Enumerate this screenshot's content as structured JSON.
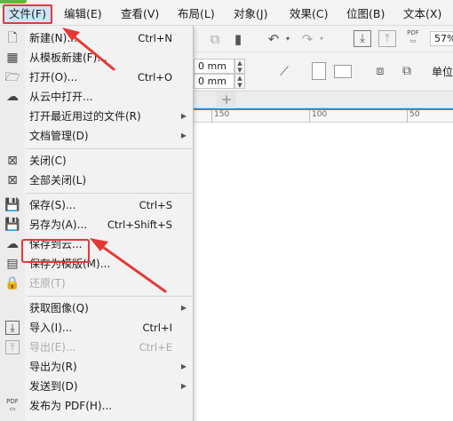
{
  "menubar": {
    "items": [
      {
        "label": "文件(F)"
      },
      {
        "label": "编辑(E)"
      },
      {
        "label": "查看(V)"
      },
      {
        "label": "布局(L)"
      },
      {
        "label": "对象(J)"
      },
      {
        "label": "效果(C)"
      },
      {
        "label": "位图(B)"
      },
      {
        "label": "文本(X)"
      }
    ]
  },
  "toolbar": {
    "zoom_value": "57%",
    "pdf_label": "PDF",
    "width_value": "0 mm",
    "height_value": "0 mm",
    "units_label": "单位"
  },
  "ruler": {
    "labels": [
      "150",
      "100",
      "50"
    ]
  },
  "file_menu": {
    "items": [
      {
        "label": "新建(N)...",
        "shortcut": "Ctrl+N",
        "icon": "new-document-icon"
      },
      {
        "label": "从模板新建(F)...",
        "shortcut": "",
        "icon": "new-from-template-icon"
      },
      {
        "label": "打开(O)...",
        "shortcut": "Ctrl+O",
        "icon": "folder-open-icon"
      },
      {
        "label": "从云中打开...",
        "shortcut": "",
        "icon": "cloud-open-icon"
      },
      {
        "label": "打开最近用过的文件(R)",
        "shortcut": "",
        "icon": "",
        "submenu": true
      },
      {
        "label": "文档管理(D)",
        "shortcut": "",
        "icon": "",
        "submenu": true
      },
      {
        "label": "关闭(C)",
        "shortcut": "",
        "icon": "close-document-icon"
      },
      {
        "label": "全部关闭(L)",
        "shortcut": "",
        "icon": "close-all-icon"
      },
      {
        "label": "保存(S)...",
        "shortcut": "Ctrl+S",
        "icon": "save-icon"
      },
      {
        "label": "另存为(A)...",
        "shortcut": "Ctrl+Shift+S",
        "icon": "save-as-icon"
      },
      {
        "label": "保存到云...",
        "shortcut": "",
        "icon": "cloud-save-icon"
      },
      {
        "label": "保存为模版(M)...",
        "shortcut": "",
        "icon": "save-template-icon"
      },
      {
        "label": "还原(T)",
        "shortcut": "",
        "icon": "revert-icon",
        "disabled": true
      },
      {
        "label": "获取图像(Q)",
        "shortcut": "",
        "icon": "",
        "submenu": true
      },
      {
        "label": "导入(I)...",
        "shortcut": "Ctrl+I",
        "icon": "import-icon"
      },
      {
        "label": "导出(E)...",
        "shortcut": "Ctrl+E",
        "icon": "export-icon",
        "disabled": true
      },
      {
        "label": "导出为(R)",
        "shortcut": "",
        "icon": "",
        "submenu": true
      },
      {
        "label": "发送到(D)",
        "shortcut": "",
        "icon": "",
        "submenu": true
      },
      {
        "label": "发布为 PDF(H)...",
        "shortcut": "",
        "icon": "pdf-icon"
      }
    ]
  },
  "colors": {
    "highlight": "#e53935",
    "accent": "#2a8bd8",
    "green": "#5bb83a"
  }
}
